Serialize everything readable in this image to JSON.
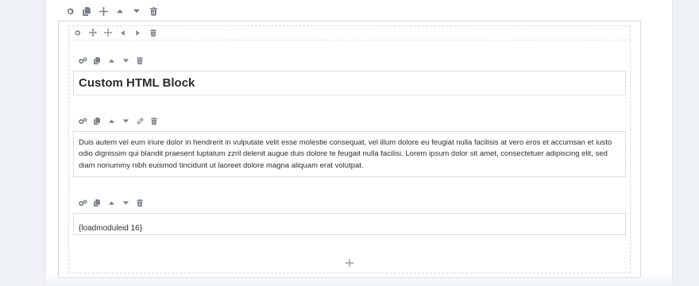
{
  "row_toolbar": {
    "icons": [
      "gear-icon",
      "copy-icon",
      "plus-icon",
      "caret-up-icon",
      "caret-down-icon",
      "trash-icon"
    ]
  },
  "column_toolbar": {
    "icons": [
      "gear-icon",
      "move-icon",
      "column-layout-icon",
      "chevron-left-icon",
      "chevron-right-icon",
      "trash-icon"
    ]
  },
  "addons": [
    {
      "type": "heading",
      "toolbar_icons": [
        "gears-icon",
        "copy-icon",
        "caret-up-icon",
        "caret-down-icon",
        "trash-icon"
      ],
      "content": "Custom HTML Block"
    },
    {
      "type": "text",
      "toolbar_icons": [
        "gears-icon",
        "copy-icon",
        "caret-up-icon",
        "caret-down-icon",
        "link-icon",
        "trash-icon"
      ],
      "content": "Duis autem vel eum iriure dolor in hendrerit in vulputate velit esse molestie consequat, vel illum dolore eu feugiat nulla facilisis at vero eros et accumsan et iusto odio dignissim qui blandit praesent luptatum zzril delenit augue duis dolore te feugait nulla facilisi. Lorem ipsum dolor sit amet, consectetuer adipiscing elit, sed diam nonummy nibh euismod tincidunt ut laoreet dolore magna aliquam erat volutpat."
    },
    {
      "type": "module",
      "toolbar_icons": [
        "gears-icon",
        "copy-icon",
        "caret-up-icon",
        "caret-down-icon",
        "trash-icon"
      ],
      "content": "{loadmoduleid 16}"
    }
  ],
  "add_addon": {
    "icon": "plus-icon"
  },
  "colors": {
    "icon": "#7a7f87",
    "border": "#d6d9de",
    "background": "#eef1f6"
  }
}
